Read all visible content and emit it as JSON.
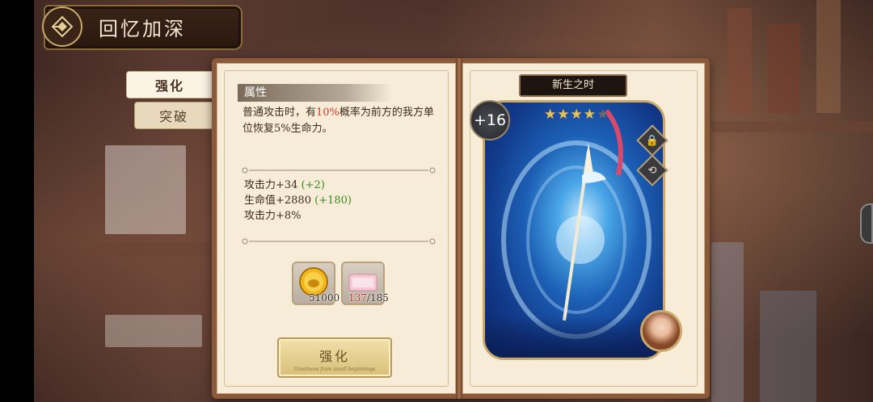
{
  "header": {
    "title": "回忆加深"
  },
  "tabs": [
    {
      "label": "强化",
      "active": true
    },
    {
      "label": "突破",
      "active": false
    }
  ],
  "attributes": {
    "section_label": "属性",
    "description_before": "普通攻击时，有",
    "description_highlight": "10%",
    "description_after": "概率为前方的我方单位恢复5%生命力。",
    "stats": [
      {
        "text": "攻击力+34",
        "bonus": "(+2)"
      },
      {
        "text": "生命值+2880",
        "bonus": "(+180)"
      },
      {
        "text": "攻击力+8%",
        "bonus": ""
      }
    ]
  },
  "materials": [
    {
      "icon": "gold-coin-icon",
      "count": "51000"
    },
    {
      "icon": "pink-ticket-icon",
      "owned": "137",
      "required": "/185"
    }
  ],
  "enhance_button": {
    "label": "强化",
    "subtitle": "Greatness from small beginnings"
  },
  "card": {
    "name": "新生之时",
    "level": "+16",
    "stars_total": 5,
    "stars_filled": 4
  },
  "colors": {
    "highlight_red": "#e0342a",
    "bonus_green": "#3b8a1e",
    "gold_trim": "#c9a86a"
  }
}
